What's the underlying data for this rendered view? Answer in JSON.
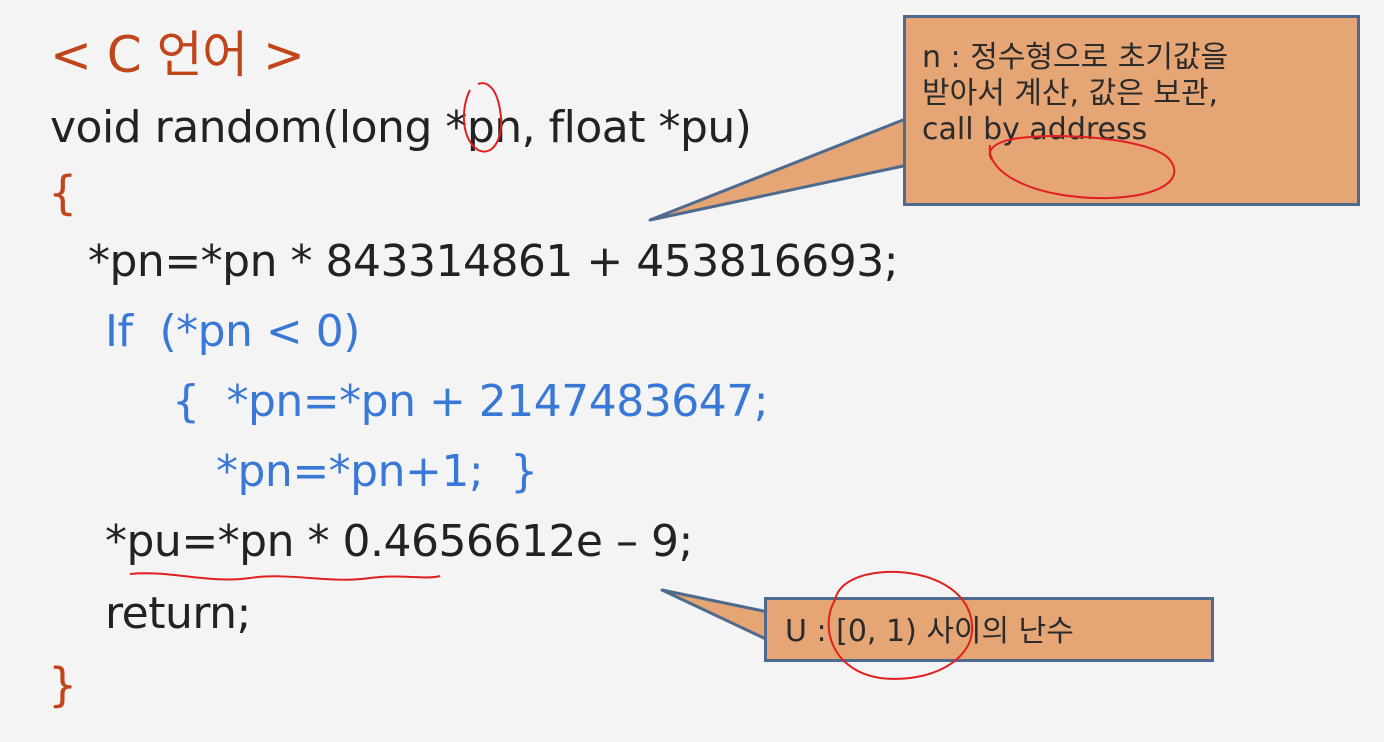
{
  "slide": {
    "title": "< C 언어 >",
    "code": {
      "signature": "void random(long *pn, float *pu)",
      "open_brace": "{",
      "line_mul": "*pn=*pn * 843314861 + 453816693;",
      "line_if": "If  (*pn < 0)",
      "line_add": "{  *pn=*pn + 2147483647;",
      "line_inc": "*pn=*pn+1;  }",
      "line_pu": "*pu=*pn * 0.4656612e – 9;",
      "line_return": "return;",
      "close_brace": "}"
    },
    "callout_n": {
      "lines": [
        "n : 정수형으로 초기값을",
        "받아서 계산, 값은 보관,",
        "call by address"
      ]
    },
    "callout_u": {
      "text": "U : [0, 1) 사이의 난수"
    }
  },
  "colors": {
    "title": "#c0451a",
    "code_default": "#222222",
    "code_blue": "#3a78d8",
    "callout_fill": "#e5a575",
    "callout_border": "#4e6a8e",
    "annotation_ink": "#e02020"
  }
}
